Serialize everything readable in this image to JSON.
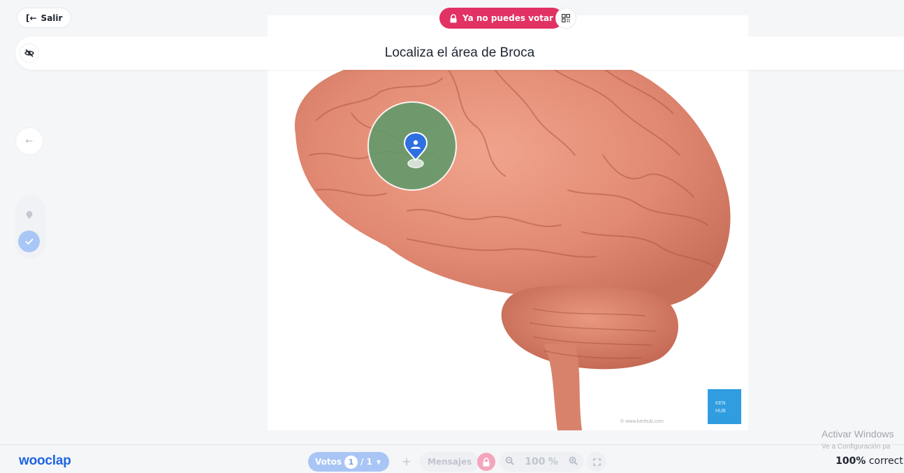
{
  "top": {
    "exit_label": "Salir",
    "vote_status": "Ya no puedes votar"
  },
  "question": {
    "title": "Localiza el área de Broca"
  },
  "bottom": {
    "logo": "wooclap",
    "votes_label": "Votos",
    "votes_count": "1",
    "votes_total": "/ 1",
    "plus": "+",
    "messages_label": "Mensajes",
    "zoom_value": "100",
    "zoom_unit": "%",
    "correct_percent": "100%",
    "correct_word": "correct"
  },
  "system": {
    "activate_title": "Activar Windows",
    "activate_sub": "Ve a Configuración pa"
  },
  "colors": {
    "accent": "#e23163",
    "brand": "#1f64e0",
    "answer_zone": "#5f9a6a",
    "pin": "#2f6fe0"
  },
  "icons": {
    "exit": "exit-icon",
    "lock": "lock-icon",
    "qr": "qr-code-icon",
    "hide": "eye-off-icon",
    "back": "arrow-left-icon",
    "pin": "map-pin-icon",
    "check": "check-icon",
    "zoom_out": "zoom-out-icon",
    "zoom_in": "zoom-in-icon",
    "fullscreen": "fullscreen-icon"
  }
}
